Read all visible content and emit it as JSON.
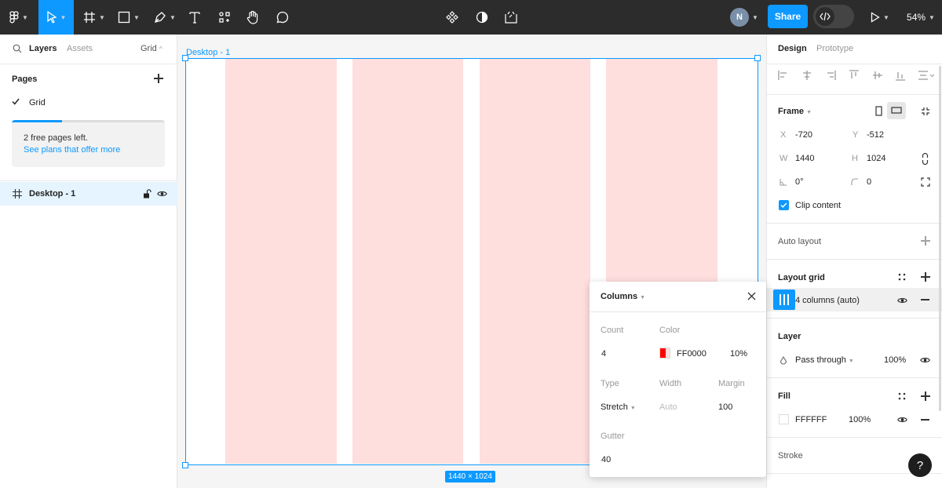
{
  "toolbar": {
    "share_label": "Share",
    "avatar_initial": "N",
    "zoom": "54%"
  },
  "left": {
    "tabs": {
      "layers": "Layers",
      "assets": "Assets",
      "page_switch": "Grid"
    },
    "pages_title": "Pages",
    "pages": [
      {
        "label": "Grid",
        "selected": true
      }
    ],
    "upsell": {
      "text": "2 free pages left.",
      "link": "See plans that offer more",
      "progress": 0.33
    },
    "layers": [
      {
        "label": "Desktop - 1"
      }
    ]
  },
  "canvas": {
    "frame_label": "Desktop - 1",
    "size_badge": "1440 × 1024",
    "grid_color": "#FF0000",
    "grid_opacity": 0.1,
    "columns": 4
  },
  "right": {
    "tabs": {
      "design": "Design",
      "prototype": "Prototype"
    },
    "frame": {
      "title": "Frame",
      "x_label": "X",
      "x": "-720",
      "y_label": "Y",
      "y": "-512",
      "w_label": "W",
      "w": "1440",
      "h_label": "H",
      "h": "1024",
      "rotation": "0°",
      "radius": "0",
      "clip_label": "Clip content",
      "clip": true
    },
    "auto_layout": "Auto layout",
    "layout_grid": {
      "title": "Layout grid",
      "item": "4 columns (auto)"
    },
    "layer": {
      "title": "Layer",
      "blend": "Pass through",
      "opacity": "100%"
    },
    "fill": {
      "title": "Fill",
      "hex": "FFFFFF",
      "opacity": "100%"
    },
    "stroke": "Stroke",
    "help": "?"
  },
  "popup": {
    "title": "Columns",
    "count_label": "Count",
    "count": "4",
    "color_label": "Color",
    "color_hex": "FF0000",
    "color_opacity": "10%",
    "type_label": "Type",
    "type": "Stretch",
    "width_label": "Width",
    "width": "Auto",
    "margin_label": "Margin",
    "margin": "100",
    "gutter_label": "Gutter",
    "gutter": "40"
  }
}
